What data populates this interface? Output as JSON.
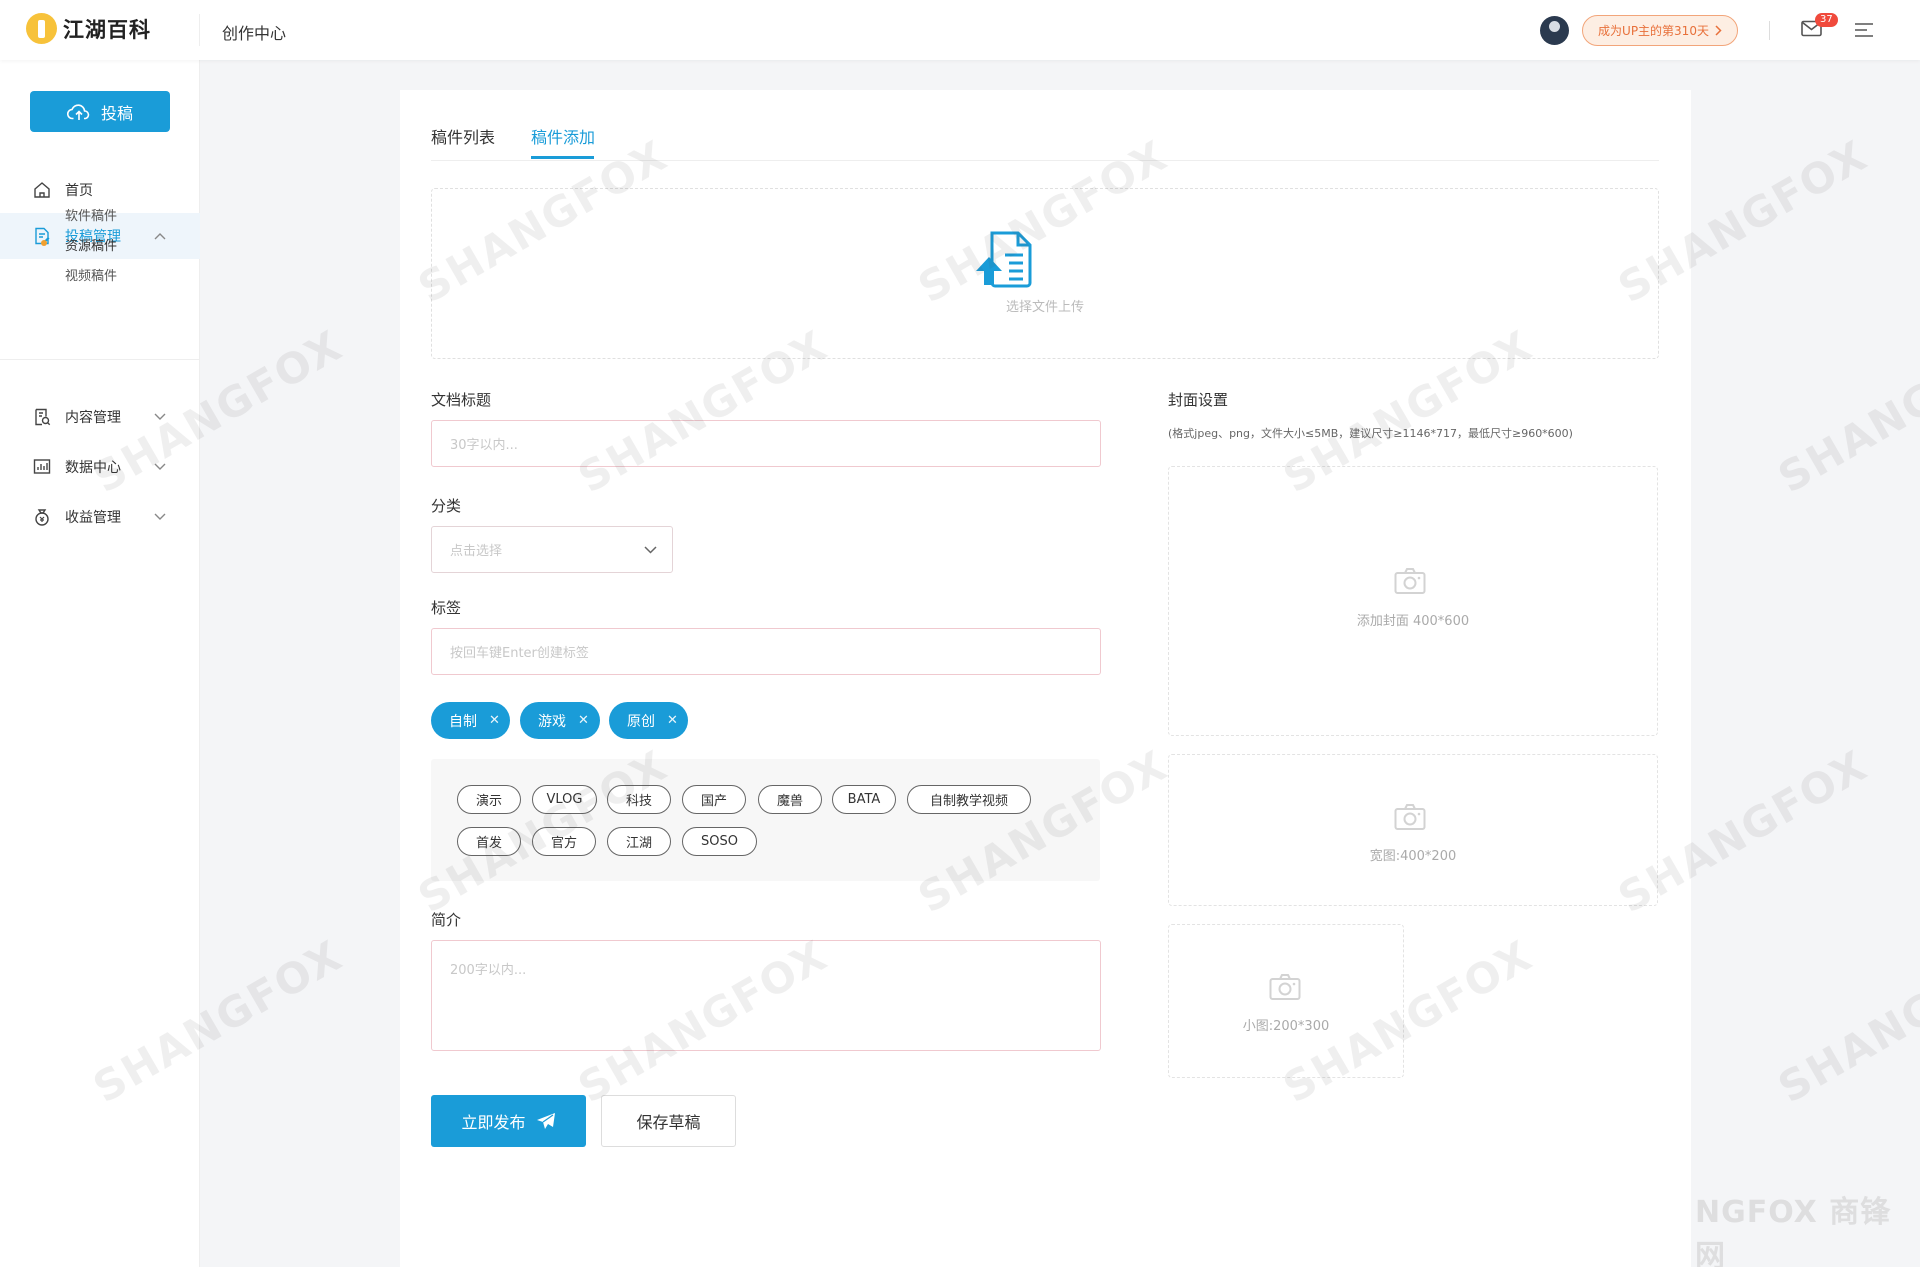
{
  "header": {
    "logo_text": "江湖百科",
    "section_title": "创作中心",
    "up_badge": "成为UP主的第310天",
    "mail_count": "37"
  },
  "sidebar": {
    "submit_button": "投稿",
    "items": [
      {
        "label": "首页",
        "icon": "home-icon"
      },
      {
        "label": "投稿管理",
        "icon": "document-edit-icon",
        "expanded": true
      },
      {
        "label": "内容管理",
        "icon": "content-search-icon"
      },
      {
        "label": "数据中心",
        "icon": "chart-icon"
      },
      {
        "label": "收益管理",
        "icon": "money-bag-icon"
      }
    ],
    "sub_items": [
      "软件稿件",
      "资源稿件",
      "视频稿件"
    ],
    "active_sub": "资源稿件",
    "accent_color": "#1a9cd8",
    "active_dot_color": "#f0a030"
  },
  "tabs": [
    "稿件列表",
    "稿件添加"
  ],
  "active_tab": "稿件添加",
  "upload": {
    "text": "选择文件上传"
  },
  "form": {
    "title_label": "文档标题",
    "title_placeholder": "30字以内...",
    "category_label": "分类",
    "category_placeholder": "点击选择",
    "tags_label": "标签",
    "tags_placeholder": "按回车键Enter创建标签",
    "selected_tags": [
      "自制",
      "游戏",
      "原创"
    ],
    "suggested_tags": [
      "演示",
      "VLOG",
      "科技",
      "国产",
      "魔兽",
      "BATA",
      "自制教学视频",
      "首发",
      "官方",
      "江湖",
      "SOSO"
    ],
    "intro_label": "简介",
    "intro_placeholder": "200字以内...",
    "publish_button": "立即发布",
    "draft_button": "保存草稿"
  },
  "cover": {
    "title": "封面设置",
    "hint": "(格式jpeg、png，文件大小≤5MB，建议尺寸≥1146*717，最低尺寸≥960*600)",
    "large": "添加封面 400*600",
    "wide": "宽图:400*200",
    "small": "小图:200*300"
  },
  "watermark": {
    "text": "SHANGFOX",
    "sub": "商锋网 COM"
  },
  "footer_watermark": "NGFOX 商锋网"
}
